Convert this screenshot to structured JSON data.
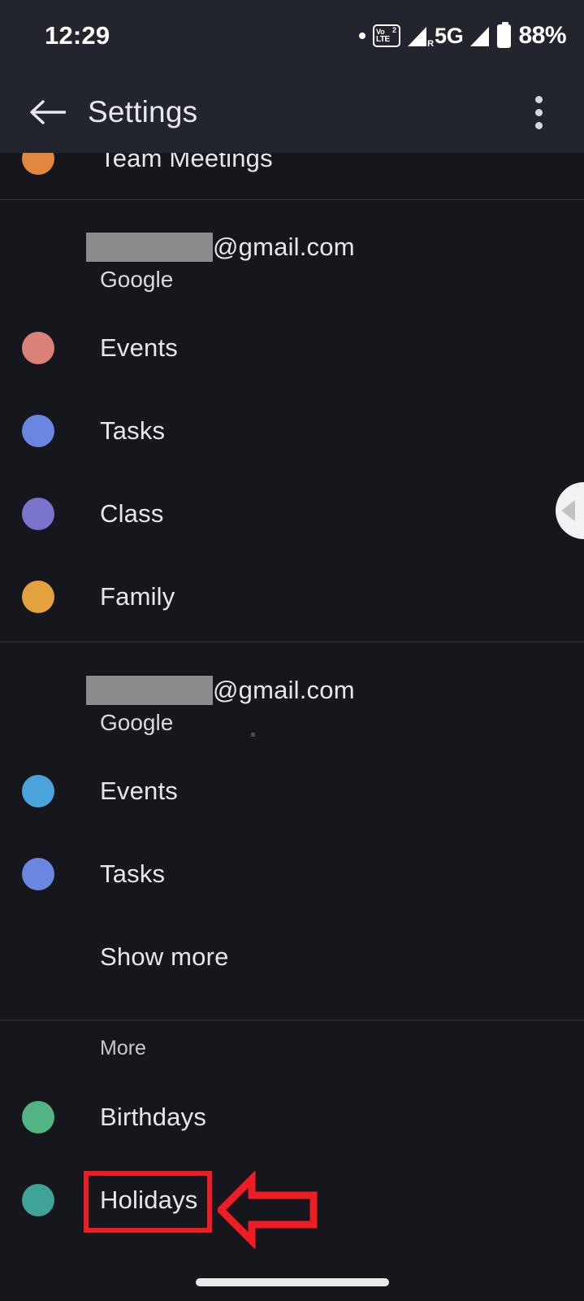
{
  "status_bar": {
    "time": "12:29",
    "notification_dot": "•",
    "volte_label_top": "Vo",
    "volte_label_bottom": "LTE",
    "sim_index": "2",
    "roaming_label": "R",
    "network_type": "5G",
    "battery_percent": "88%"
  },
  "toolbar": {
    "back_icon": "back-arrow-icon",
    "title": "Settings",
    "overflow_icon": "more-vert-icon"
  },
  "partial_row": {
    "label": "Team Meetings",
    "color": "#e28740"
  },
  "accounts": [
    {
      "email_redacted": true,
      "email_domain": "@gmail.com",
      "provider": "Google",
      "calendars": [
        {
          "label": "Events",
          "color": "#da8279"
        },
        {
          "label": "Tasks",
          "color": "#6a86e0"
        },
        {
          "label": "Class",
          "color": "#7a74cc"
        },
        {
          "label": "Family",
          "color": "#e4a23e"
        }
      ]
    },
    {
      "email_redacted": true,
      "email_domain": "@gmail.com",
      "provider": "Google",
      "calendars": [
        {
          "label": "Events",
          "color": "#4ba3dc"
        },
        {
          "label": "Tasks",
          "color": "#6a86e0"
        }
      ],
      "show_more_label": "Show more"
    }
  ],
  "more_section": {
    "header": "More",
    "items": [
      {
        "label": "Birthdays",
        "color": "#52b482"
      },
      {
        "label": "Holidays",
        "color": "#3fa397"
      }
    ]
  },
  "edge_panel": {
    "handle_icon": "chevron-left-icon"
  },
  "annotation": {
    "color": "#f01c24",
    "highlight_target": "Holidays",
    "arrow_icon": "left-arrow-annotation-icon"
  },
  "navigation": {
    "gesture_pill": "home-gesture-pill"
  }
}
